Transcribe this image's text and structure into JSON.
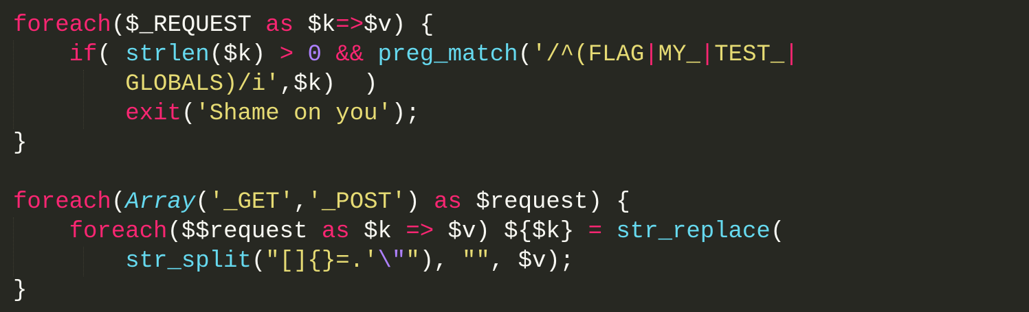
{
  "colors": {
    "background": "#272822",
    "default": "#f8f8f2",
    "keyword": "#f92672",
    "function": "#66d9ef",
    "string": "#e6db74",
    "number": "#ae81ff",
    "storage_italic": "#66d9ef",
    "indent_guide": "#3e3d32"
  },
  "lines": [
    {
      "tokens": [
        {
          "text": "foreach",
          "color": "#f92672"
        },
        {
          "text": "($_REQUEST ",
          "color": "#f8f8f2"
        },
        {
          "text": "as",
          "color": "#f92672"
        },
        {
          "text": " $k",
          "color": "#f8f8f2"
        },
        {
          "text": "=>",
          "color": "#f92672"
        },
        {
          "text": "$v) {",
          "color": "#f8f8f2"
        }
      ]
    },
    {
      "tokens": [
        {
          "text": "    ",
          "color": "#f8f8f2"
        },
        {
          "text": "if",
          "color": "#f92672"
        },
        {
          "text": "( ",
          "color": "#f8f8f2"
        },
        {
          "text": "strlen",
          "color": "#66d9ef"
        },
        {
          "text": "($k) ",
          "color": "#f8f8f2"
        },
        {
          "text": ">",
          "color": "#f92672"
        },
        {
          "text": " ",
          "color": "#f8f8f2"
        },
        {
          "text": "0",
          "color": "#ae81ff"
        },
        {
          "text": " ",
          "color": "#f8f8f2"
        },
        {
          "text": "&&",
          "color": "#f92672"
        },
        {
          "text": " ",
          "color": "#f8f8f2"
        },
        {
          "text": "preg_match",
          "color": "#66d9ef"
        },
        {
          "text": "(",
          "color": "#f8f8f2"
        },
        {
          "text": "'/^(FLAG",
          "color": "#e6db74"
        },
        {
          "text": "|",
          "color": "#f92672"
        },
        {
          "text": "MY_",
          "color": "#e6db74"
        },
        {
          "text": "|",
          "color": "#f92672"
        },
        {
          "text": "TEST_",
          "color": "#e6db74"
        },
        {
          "text": "|",
          "color": "#f92672"
        }
      ]
    },
    {
      "tokens": [
        {
          "text": "        ",
          "color": "#f8f8f2"
        },
        {
          "text": "GLOBALS)/i'",
          "color": "#e6db74"
        },
        {
          "text": ",$k)  )",
          "color": "#f8f8f2"
        }
      ]
    },
    {
      "tokens": [
        {
          "text": "        ",
          "color": "#f8f8f2"
        },
        {
          "text": "exit",
          "color": "#f92672"
        },
        {
          "text": "(",
          "color": "#f8f8f2"
        },
        {
          "text": "'Shame on you'",
          "color": "#e6db74"
        },
        {
          "text": ");",
          "color": "#f8f8f2"
        }
      ]
    },
    {
      "tokens": [
        {
          "text": "}",
          "color": "#f8f8f2"
        }
      ]
    },
    {
      "tokens": []
    },
    {
      "tokens": [
        {
          "text": "foreach",
          "color": "#f92672"
        },
        {
          "text": "(",
          "color": "#f8f8f2"
        },
        {
          "text": "Array",
          "color": "#66d9ef",
          "italic": true
        },
        {
          "text": "(",
          "color": "#f8f8f2"
        },
        {
          "text": "'_GET'",
          "color": "#e6db74"
        },
        {
          "text": ",",
          "color": "#f8f8f2"
        },
        {
          "text": "'_POST'",
          "color": "#e6db74"
        },
        {
          "text": ") ",
          "color": "#f8f8f2"
        },
        {
          "text": "as",
          "color": "#f92672"
        },
        {
          "text": " $request) {",
          "color": "#f8f8f2"
        }
      ]
    },
    {
      "tokens": [
        {
          "text": "    ",
          "color": "#f8f8f2"
        },
        {
          "text": "foreach",
          "color": "#f92672"
        },
        {
          "text": "($$request ",
          "color": "#f8f8f2"
        },
        {
          "text": "as",
          "color": "#f92672"
        },
        {
          "text": " $k ",
          "color": "#f8f8f2"
        },
        {
          "text": "=>",
          "color": "#f92672"
        },
        {
          "text": " $v) ${$k} ",
          "color": "#f8f8f2"
        },
        {
          "text": "=",
          "color": "#f92672"
        },
        {
          "text": " ",
          "color": "#f8f8f2"
        },
        {
          "text": "str_replace",
          "color": "#66d9ef"
        },
        {
          "text": "(",
          "color": "#f8f8f2"
        }
      ]
    },
    {
      "tokens": [
        {
          "text": "        ",
          "color": "#f8f8f2"
        },
        {
          "text": "str_split",
          "color": "#66d9ef"
        },
        {
          "text": "(",
          "color": "#f8f8f2"
        },
        {
          "text": "\"[]{}=.'",
          "color": "#e6db74"
        },
        {
          "text": "\\\"",
          "color": "#ae81ff"
        },
        {
          "text": "\"",
          "color": "#e6db74"
        },
        {
          "text": "), ",
          "color": "#f8f8f2"
        },
        {
          "text": "\"\"",
          "color": "#e6db74"
        },
        {
          "text": ", $v);",
          "color": "#f8f8f2"
        }
      ]
    },
    {
      "tokens": [
        {
          "text": "}",
          "color": "#f8f8f2"
        }
      ]
    }
  ]
}
